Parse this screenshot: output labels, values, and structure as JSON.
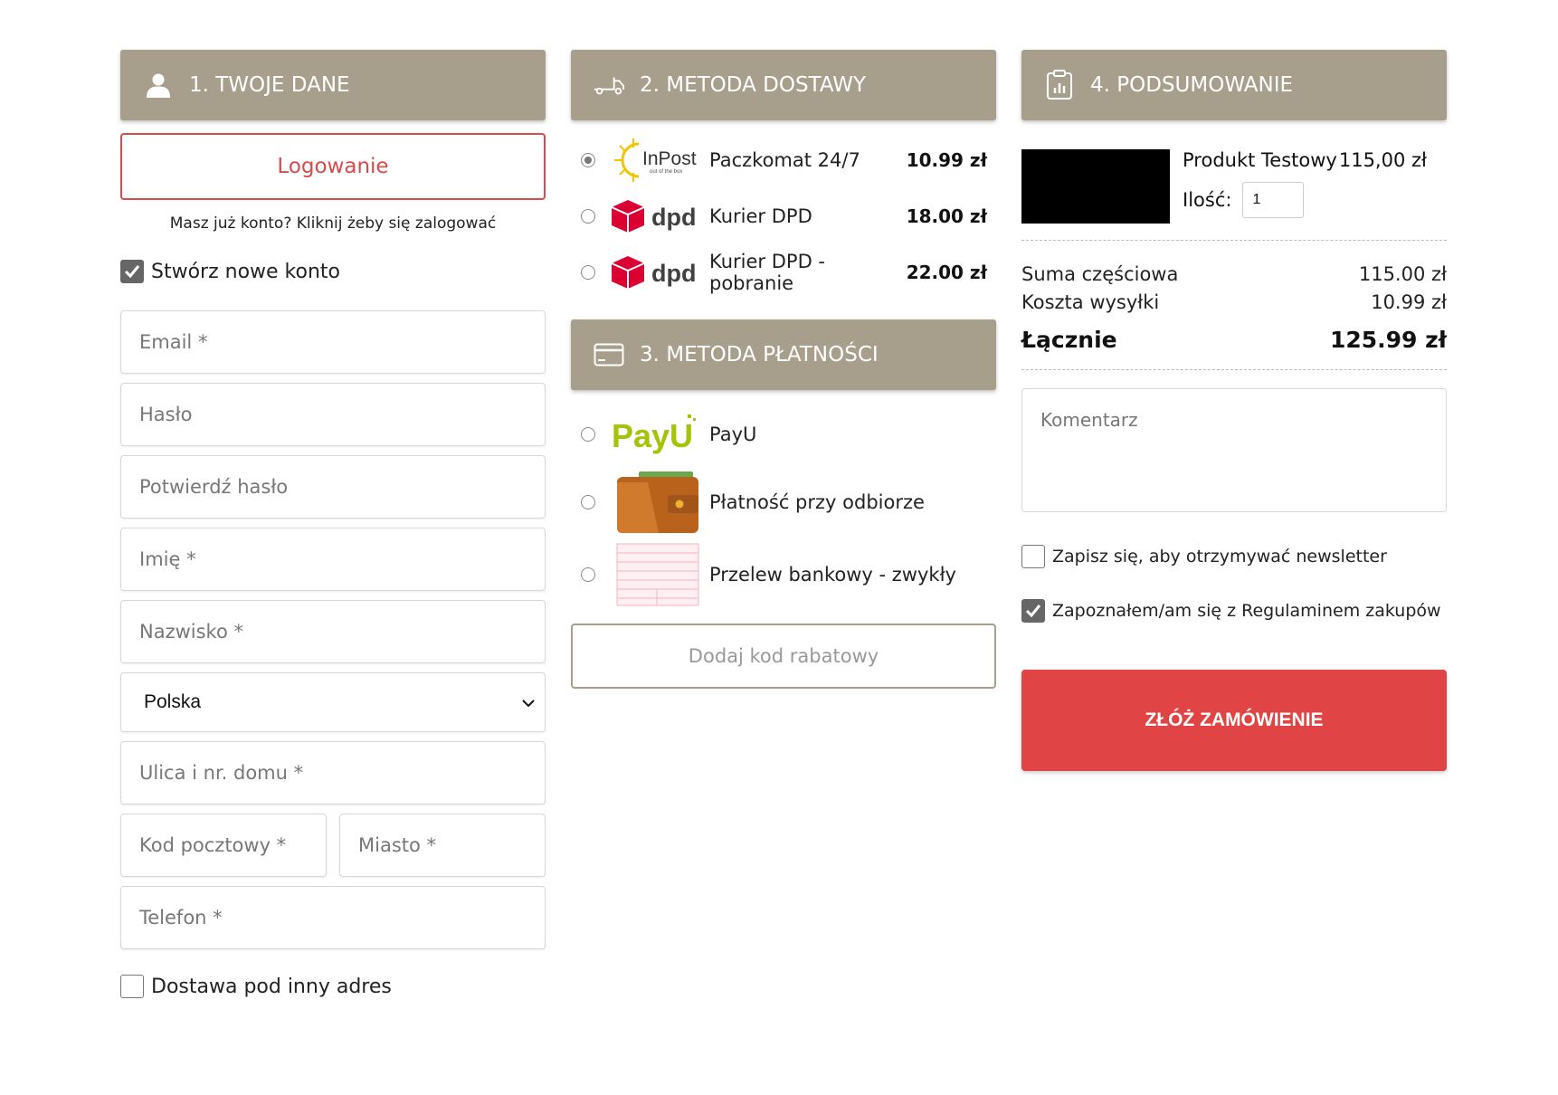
{
  "personal": {
    "header": "1. TWOJE DANE",
    "login_label": "Logowanie",
    "login_hint": "Masz już konto? Kliknij żeby się zalogować",
    "create_account_label": "Stwórz nowe konto",
    "create_account_checked": true,
    "fields": {
      "email": "Email *",
      "password": "Hasło",
      "confirm_password": "Potwierdź hasło",
      "first_name": "Imię *",
      "last_name": "Nazwisko *",
      "country": "Polska",
      "street": "Ulica i nr. domu *",
      "postal_code": "Kod pocztowy *",
      "city": "Miasto *",
      "phone": "Telefon *"
    },
    "other_address_label": "Dostawa pod inny adres",
    "other_address_checked": false
  },
  "shipping": {
    "header": "2. METODA DOSTAWY",
    "options": [
      {
        "name": "Paczkomat 24/7",
        "price": "10.99 zł",
        "selected": true,
        "logo": "inpost-logo",
        "logo_text": "InPost",
        "logo_sub": "out of the box"
      },
      {
        "name": "Kurier DPD",
        "price": "18.00 zł",
        "selected": false,
        "logo": "dpd-logo",
        "logo_text": "dpd"
      },
      {
        "name": "Kurier DPD - pobranie",
        "price": "22.00 zł",
        "selected": false,
        "logo": "dpd-logo",
        "logo_text": "dpd"
      }
    ]
  },
  "payment": {
    "header": "3. METODA PŁATNOŚCI",
    "options": [
      {
        "name": "PayU",
        "selected": false,
        "logo": "payu-logo",
        "logo_text": "PayU"
      },
      {
        "name": "Płatność przy odbiorze",
        "selected": false,
        "logo": "wallet-icon"
      },
      {
        "name": "Przelew bankowy - zwykły",
        "selected": false,
        "logo": "bank-transfer-icon"
      }
    ],
    "discount_label": "Dodaj kod rabatowy"
  },
  "summary": {
    "header": "4. PODSUMOWANIE",
    "product_name": "Produkt Testowy",
    "product_price": "115,00 zł",
    "qty_label": "Ilość:",
    "qty_value": "1",
    "subtotal_label": "Suma częściowa",
    "subtotal_value": "115.00 zł",
    "shipping_label": "Koszta wysyłki",
    "shipping_value": "10.99 zł",
    "total_label": "Łącznie",
    "total_value": "125.99 zł",
    "comment_placeholder": "Komentarz",
    "newsletter_label": "Zapisz się, aby otrzymywać newsletter",
    "newsletter_checked": false,
    "terms_label": "Zapoznałem/am się z Regulaminem zakupów",
    "terms_checked": true,
    "order_label": "ZŁÓŻ ZAMÓWIENIE"
  },
  "colors": {
    "header_bg": "#a89e8c",
    "accent_red": "#e04444",
    "login_border": "#d94a4a"
  }
}
